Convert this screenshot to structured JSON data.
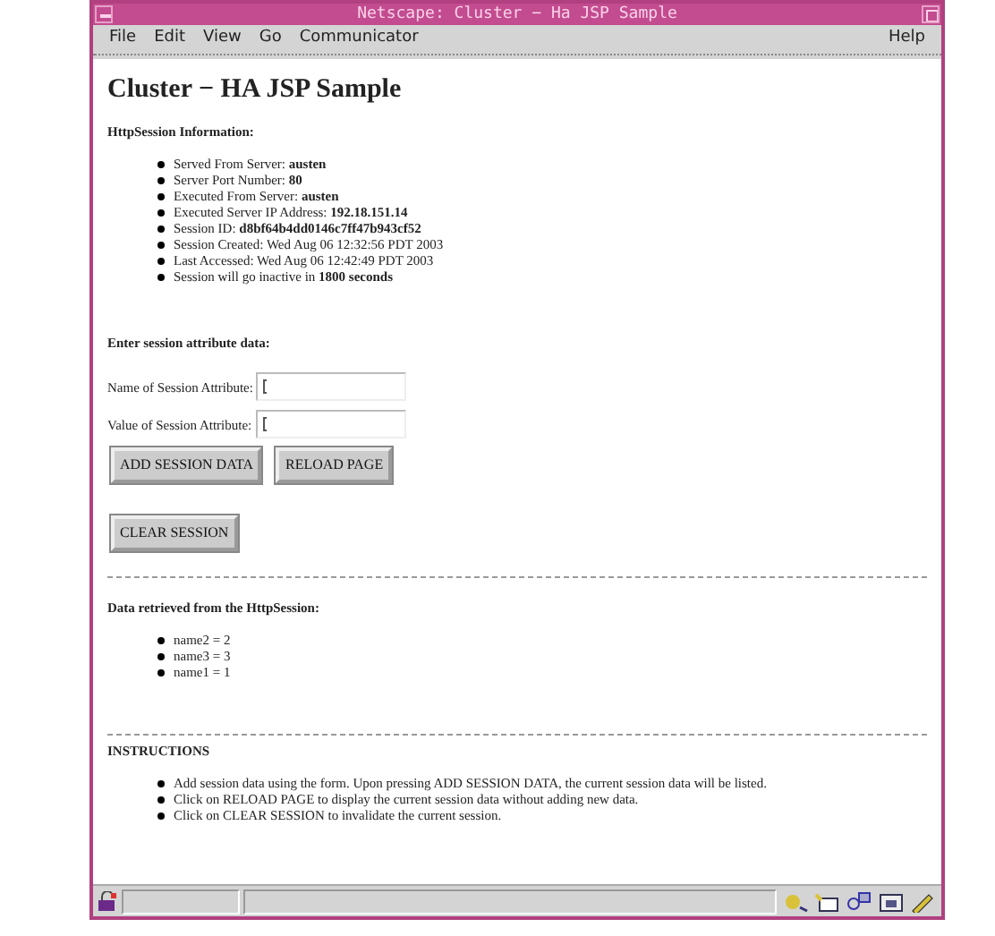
{
  "window": {
    "title": "Netscape: Cluster − Ha JSP Sample"
  },
  "menu": [
    {
      "label": "File"
    },
    {
      "label": "Edit"
    },
    {
      "label": "View"
    },
    {
      "label": "Go"
    },
    {
      "label": "Communicator"
    }
  ],
  "help_menu": {
    "label": "Help"
  },
  "heading": "Cluster − HA JSP Sample",
  "session_info": {
    "title": "HttpSession Information:",
    "items": [
      "Served From Server: **austen**",
      "Server Port Number: **80**",
      "Executed From Server: **austen**",
      "Executed Server IP Address: **192.18.151.14**",
      "Session ID: **d8bf64b4dd0146c7ff47b943cf52**",
      "Session Created: Wed Aug 06 12:32:56 PDT 2003",
      "Last Accessed: Wed Aug 06 12:42:49 PDT 2003",
      "Session will go inactive in **1800 seconds**"
    ]
  },
  "form": {
    "title": "Enter session attribute data:",
    "fields": [
      {
        "label": "Name of Session Attribute:"
      },
      {
        "label": "Value of Session Attribute:"
      }
    ],
    "buttons": [
      "ADD SESSION DATA",
      "RELOAD PAGE"
    ],
    "clear_button": "CLEAR SESSION"
  },
  "retrieved": {
    "title": "Data retrieved from the HttpSession:",
    "items": [
      "name2 = 2",
      "name3 = 3",
      "name1 = 1"
    ]
  },
  "instructions": {
    "title": "INSTRUCTIONS",
    "items": [
      "Add session data using the form. Upon pressing ADD SESSION DATA, the current session data will be listed.",
      "Click on RELOAD PAGE to display the current session data without adding new data.",
      "Click on CLEAR SESSION to invalidate the current session."
    ]
  }
}
